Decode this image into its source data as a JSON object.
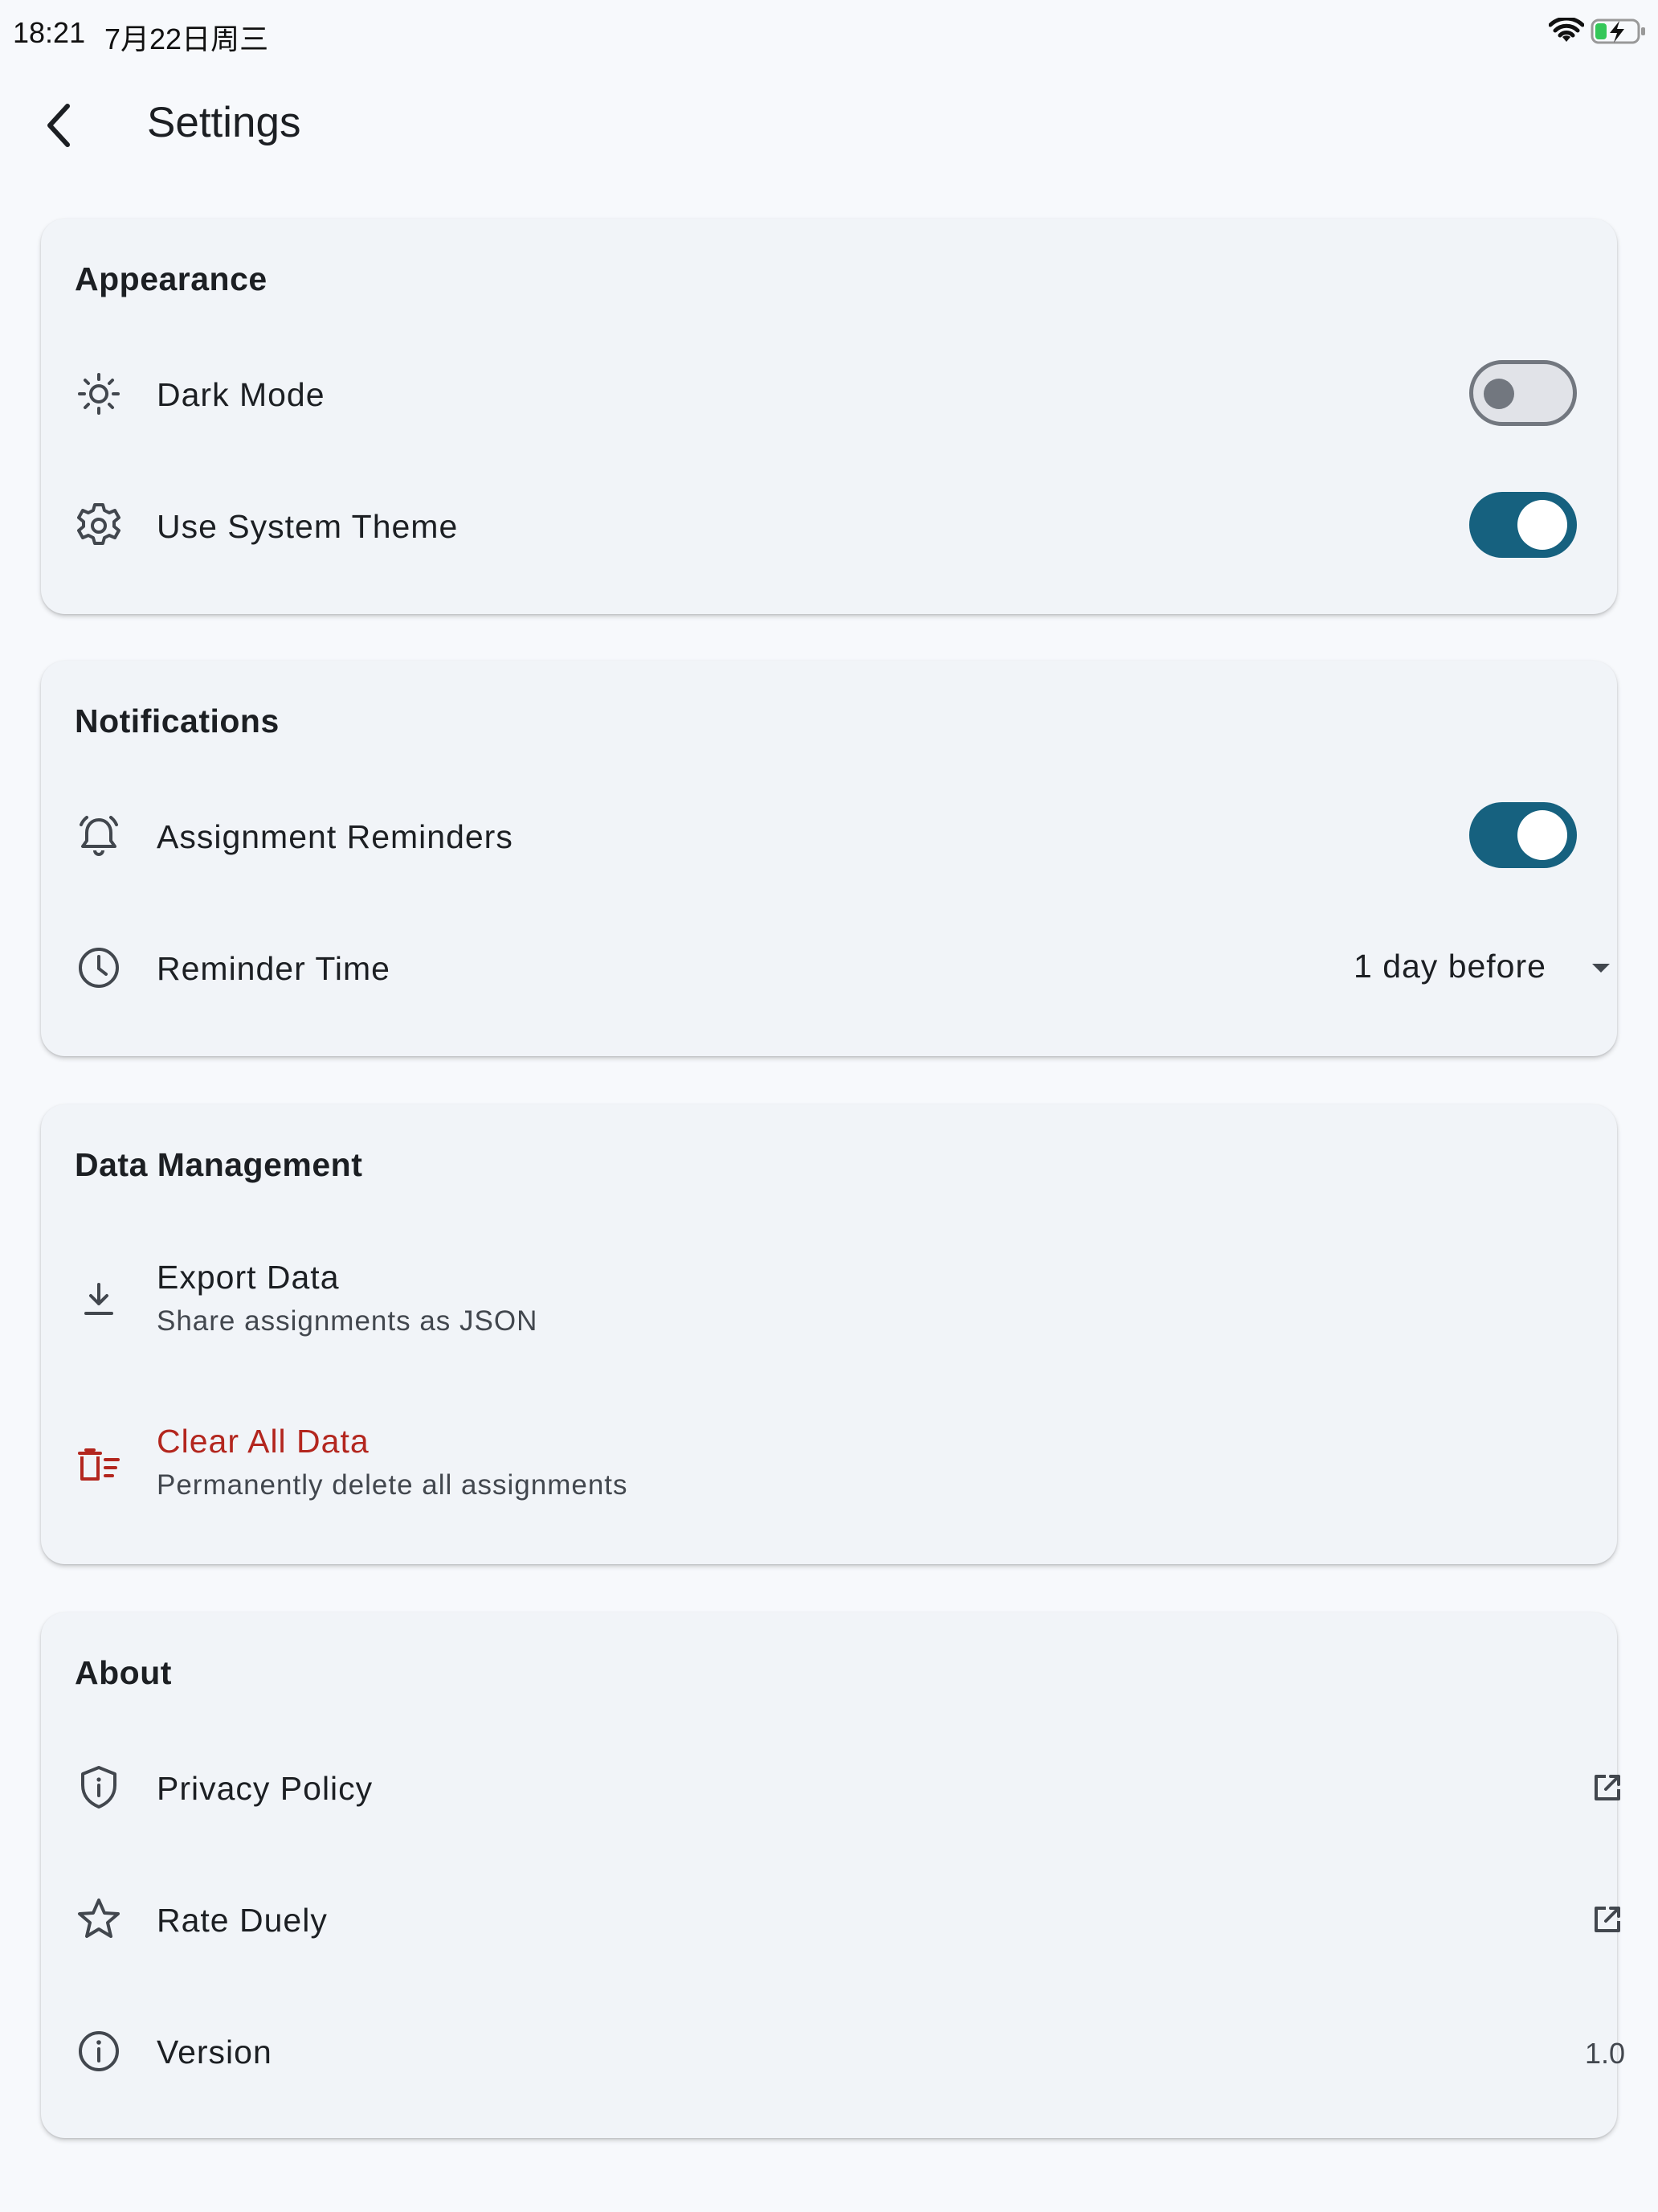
{
  "status_bar": {
    "time": "18:21",
    "date": "7月22日周三"
  },
  "app_bar": {
    "title": "Settings"
  },
  "sections": {
    "appearance": {
      "title": "Appearance",
      "dark_mode": {
        "label": "Dark Mode",
        "enabled": false
      },
      "system_theme": {
        "label": "Use System Theme",
        "enabled": true
      }
    },
    "notifications": {
      "title": "Notifications",
      "reminders": {
        "label": "Assignment Reminders",
        "enabled": true
      },
      "reminder_time": {
        "label": "Reminder Time",
        "value": "1 day before"
      }
    },
    "data_management": {
      "title": "Data Management",
      "export": {
        "label": "Export Data",
        "subtitle": "Share assignments as JSON"
      },
      "clear": {
        "label": "Clear All Data",
        "subtitle": "Permanently delete all assignments"
      }
    },
    "about": {
      "title": "About",
      "privacy": {
        "label": "Privacy Policy"
      },
      "rate": {
        "label": "Rate Duely"
      },
      "version": {
        "label": "Version",
        "value": "1.0"
      }
    }
  },
  "colors": {
    "accent": "#16617f",
    "danger": "#b3261e",
    "surface": "#f1f4f8",
    "background": "#f7f9fc"
  },
  "icons": [
    "back-arrow-icon",
    "sun-icon",
    "gear-icon",
    "alarm-bell-icon",
    "clock-icon",
    "download-icon",
    "delete-sweep-icon",
    "shield-info-icon",
    "star-icon",
    "info-icon",
    "open-in-new-icon",
    "wifi-icon",
    "battery-charging-icon",
    "dropdown-caret-icon"
  ]
}
